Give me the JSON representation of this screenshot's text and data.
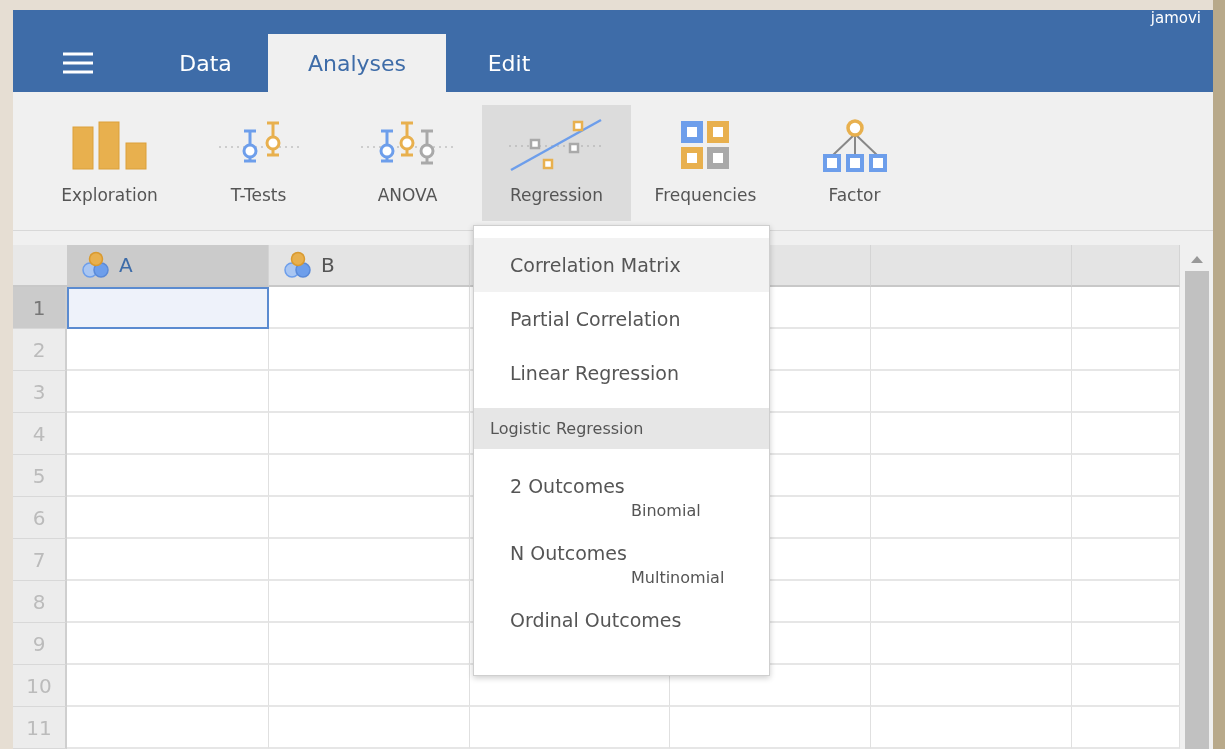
{
  "app_name": "jamovi",
  "tabs": [
    {
      "label": "Data",
      "selected": false
    },
    {
      "label": "Analyses",
      "selected": true
    },
    {
      "label": "Edit",
      "selected": false
    }
  ],
  "tools": [
    {
      "label": "Exploration",
      "selected": false
    },
    {
      "label": "T-Tests",
      "selected": false
    },
    {
      "label": "ANOVA",
      "selected": false
    },
    {
      "label": "Regression",
      "selected": true
    },
    {
      "label": "Frequencies",
      "selected": false
    },
    {
      "label": "Factor",
      "selected": false
    }
  ],
  "columns": [
    {
      "name": "A",
      "selected": true
    },
    {
      "name": "B",
      "selected": false
    }
  ],
  "rows": [
    {
      "number": "1",
      "selected": true
    },
    {
      "number": "2",
      "selected": false
    },
    {
      "number": "3",
      "selected": false
    },
    {
      "number": "4",
      "selected": false
    },
    {
      "number": "5",
      "selected": false
    },
    {
      "number": "6",
      "selected": false
    },
    {
      "number": "7",
      "selected": false
    },
    {
      "number": "8",
      "selected": false
    },
    {
      "number": "9",
      "selected": false
    },
    {
      "number": "10",
      "selected": false
    },
    {
      "number": "11",
      "selected": false
    }
  ],
  "menu": [
    {
      "kind": "item",
      "label": "Correlation Matrix",
      "selected": true
    },
    {
      "kind": "item",
      "label": "Partial Correlation",
      "selected": false
    },
    {
      "kind": "item",
      "label": "Linear Regression",
      "selected": false
    },
    {
      "kind": "header",
      "label": "Logistic Regression"
    },
    {
      "kind": "item",
      "label": "2 Outcomes",
      "subtitle": "Binomial",
      "selected": false
    },
    {
      "kind": "item",
      "label": "N Outcomes",
      "subtitle": "Multinomial",
      "selected": false
    },
    {
      "kind": "item",
      "label": "Ordinal Outcomes",
      "selected": false
    }
  ]
}
